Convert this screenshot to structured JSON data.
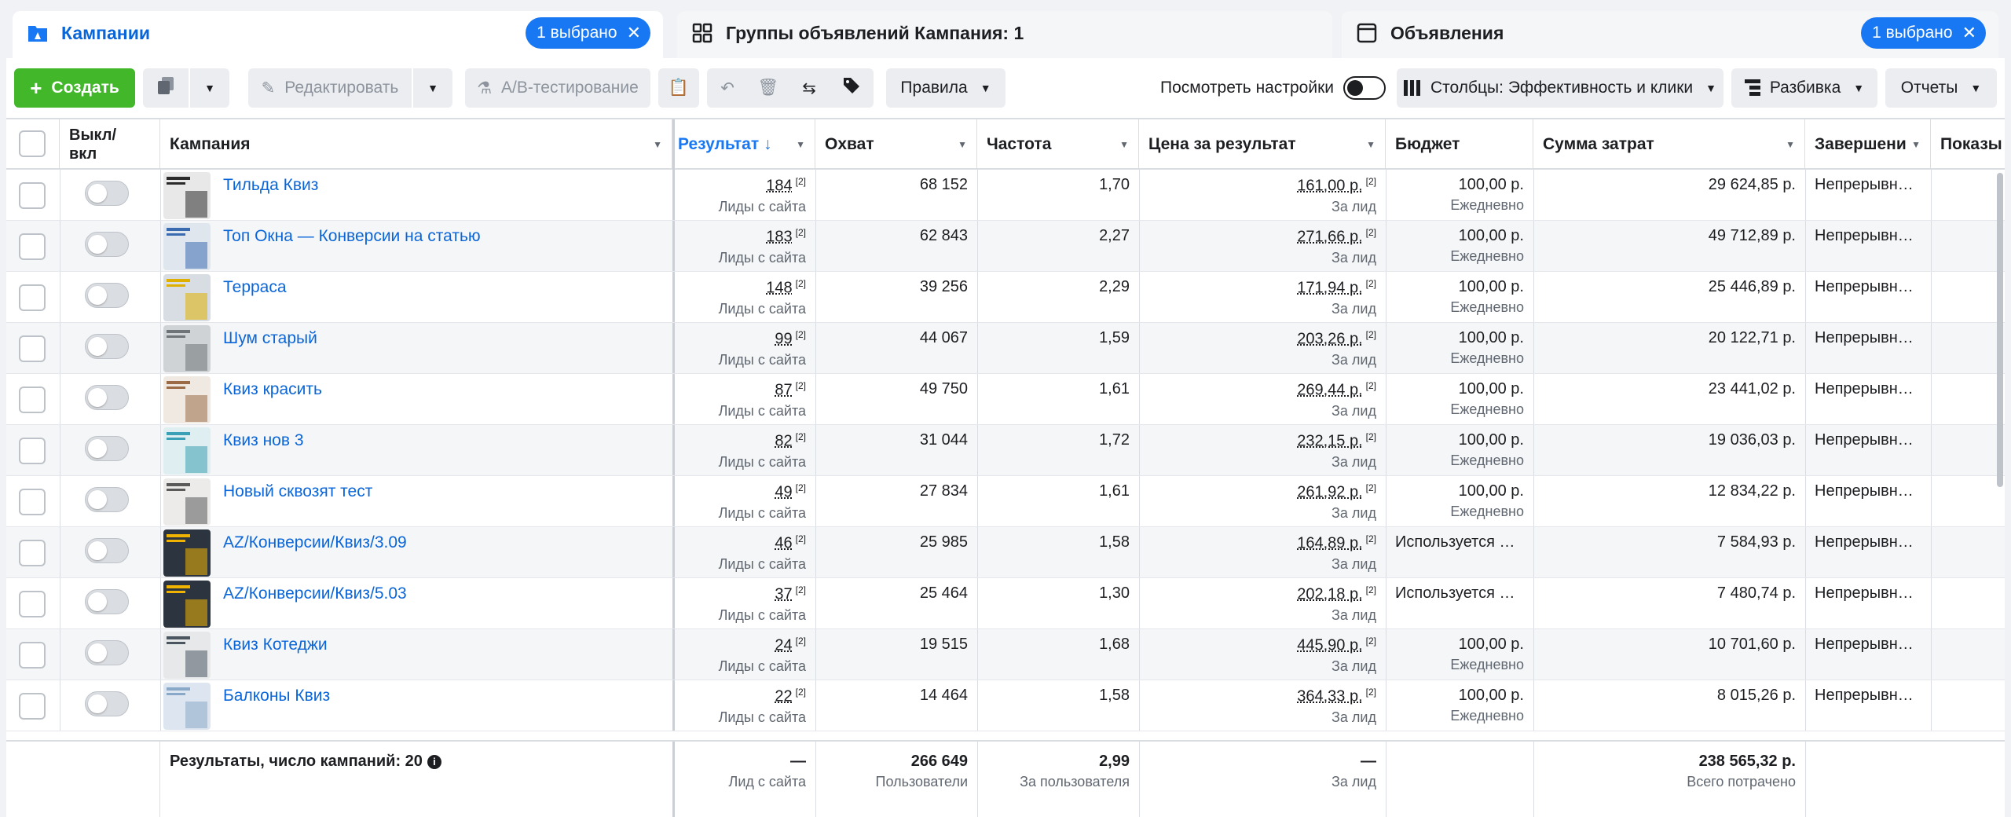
{
  "tabs": {
    "campaigns": {
      "title": "Кампании",
      "selected": "1 выбрано"
    },
    "adsets": {
      "title": "Группы объявлений Кампания: 1"
    },
    "ads": {
      "title": "Объявления",
      "selected": "1 выбрано"
    }
  },
  "toolbar": {
    "create": "Создать",
    "edit": "Редактировать",
    "ab_test": "A/B-тестирование",
    "rules": "Правила",
    "view_settings": "Посмотреть настройки",
    "columns": "Столбцы: Эффективность и клики",
    "breakdown": "Разбивка",
    "reports": "Отчеты"
  },
  "columns": {
    "toggle": "Выкл/\nвкл",
    "campaign": "Кампания",
    "result": "Результат ↓",
    "reach": "Охват",
    "frequency": "Частота",
    "cost_per_result": "Цена за результат",
    "budget": "Бюджет",
    "spent": "Сумма затрат",
    "ends": "Завершени",
    "impressions": "Показы"
  },
  "rows": [
    {
      "name": "Тильда Квиз",
      "result": "184",
      "result_sub": "Лиды с сайта",
      "reach": "68 152",
      "freq": "1,70",
      "cpr": "161,00 р.",
      "cpr_sub": "За лид",
      "budget": "100,00 р.",
      "budget_sub": "Ежедневно",
      "spent": "29 624,85 р.",
      "ends": "Непрерывн…"
    },
    {
      "name": "Топ Окна — Конверсии на статью",
      "result": "183",
      "result_sub": "Лиды с сайта",
      "reach": "62 843",
      "freq": "2,27",
      "cpr": "271,66 р.",
      "cpr_sub": "За лид",
      "budget": "100,00 р.",
      "budget_sub": "Ежедневно",
      "spent": "49 712,89 р.",
      "ends": "Непрерывн…"
    },
    {
      "name": "Терраса",
      "result": "148",
      "result_sub": "Лиды с сайта",
      "reach": "39 256",
      "freq": "2,29",
      "cpr": "171,94 р.",
      "cpr_sub": "За лид",
      "budget": "100,00 р.",
      "budget_sub": "Ежедневно",
      "spent": "25 446,89 р.",
      "ends": "Непрерывн…"
    },
    {
      "name": "Шум старый",
      "result": "99",
      "result_sub": "Лиды с сайта",
      "reach": "44 067",
      "freq": "1,59",
      "cpr": "203,26 р.",
      "cpr_sub": "За лид",
      "budget": "100,00 р.",
      "budget_sub": "Ежедневно",
      "spent": "20 122,71 р.",
      "ends": "Непрерывн…"
    },
    {
      "name": "Квиз красить",
      "result": "87",
      "result_sub": "Лиды с сайта",
      "reach": "49 750",
      "freq": "1,61",
      "cpr": "269,44 р.",
      "cpr_sub": "За лид",
      "budget": "100,00 р.",
      "budget_sub": "Ежедневно",
      "spent": "23 441,02 р.",
      "ends": "Непрерывн…"
    },
    {
      "name": "Квиз нов 3",
      "result": "82",
      "result_sub": "Лиды с сайта",
      "reach": "31 044",
      "freq": "1,72",
      "cpr": "232,15 р.",
      "cpr_sub": "За лид",
      "budget": "100,00 р.",
      "budget_sub": "Ежедневно",
      "spent": "19 036,03 р.",
      "ends": "Непрерывн…"
    },
    {
      "name": "Новый сквозят тест",
      "result": "49",
      "result_sub": "Лиды с сайта",
      "reach": "27 834",
      "freq": "1,61",
      "cpr": "261,92 р.",
      "cpr_sub": "За лид",
      "budget": "100,00 р.",
      "budget_sub": "Ежедневно",
      "spent": "12 834,22 р.",
      "ends": "Непрерывн…"
    },
    {
      "name": "AZ/Конверсии/Квиз/3.09",
      "result": "46",
      "result_sub": "Лиды с сайта",
      "reach": "25 985",
      "freq": "1,58",
      "cpr": "164,89 р.",
      "cpr_sub": "За лид",
      "budget": "Используется …",
      "budget_sub": "",
      "spent": "7 584,93 р.",
      "ends": "Непрерывн…"
    },
    {
      "name": "AZ/Конверсии/Квиз/5.03",
      "result": "37",
      "result_sub": "Лиды с сайта",
      "reach": "25 464",
      "freq": "1,30",
      "cpr": "202,18 р.",
      "cpr_sub": "За лид",
      "budget": "Используется …",
      "budget_sub": "",
      "spent": "7 480,74 р.",
      "ends": "Непрерывн…"
    },
    {
      "name": "Квиз Котеджи",
      "result": "24",
      "result_sub": "Лиды с сайта",
      "reach": "19 515",
      "freq": "1,68",
      "cpr": "445,90 р.",
      "cpr_sub": "За лид",
      "budget": "100,00 р.",
      "budget_sub": "Ежедневно",
      "spent": "10 701,60 р.",
      "ends": "Непрерывн…"
    },
    {
      "name": "Балконы Квиз",
      "result": "22",
      "result_sub": "Лиды с сайта",
      "reach": "14 464",
      "freq": "1,58",
      "cpr": "364,33 р.",
      "cpr_sub": "За лид",
      "budget": "100,00 р.",
      "budget_sub": "Ежедневно",
      "spent": "8 015,26 р.",
      "ends": "Непрерывн…"
    }
  ],
  "footer": {
    "summary": "Результаты, число кампаний: 20",
    "result": "—",
    "result_sub": "Лид с сайта",
    "reach": "266 649",
    "reach_sub": "Пользователи",
    "freq": "2,99",
    "freq_sub": "За пользователя",
    "cpr": "—",
    "cpr_sub": "За лид",
    "spent": "238 565,32 р.",
    "spent_sub": "Всего потрачено"
  },
  "colors": {
    "accent": "#1877f2",
    "create": "#42b72a",
    "link": "#0a66d8"
  }
}
